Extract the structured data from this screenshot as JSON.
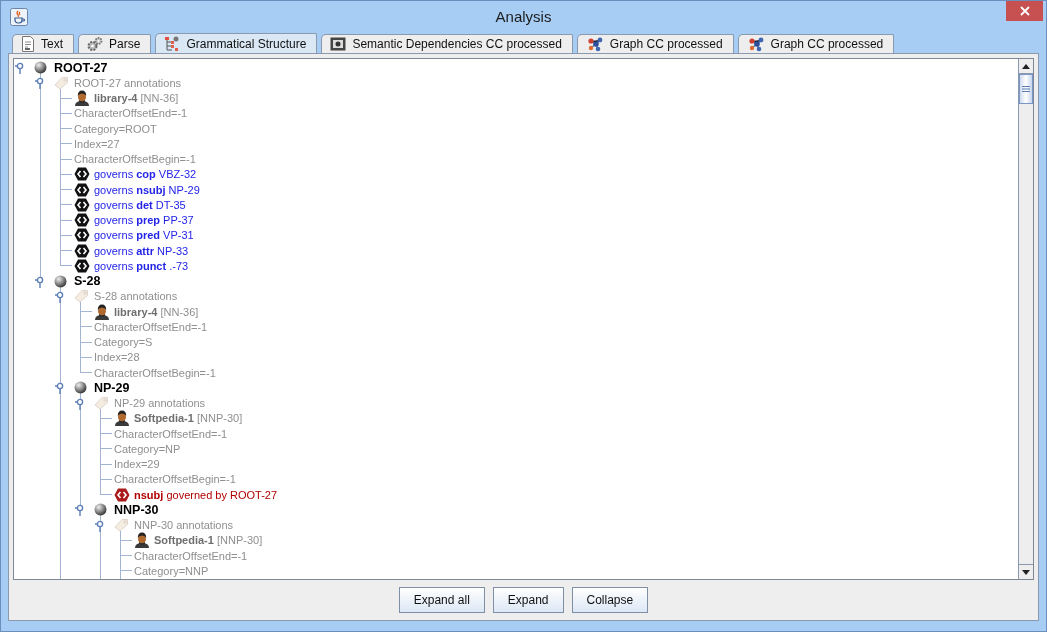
{
  "window": {
    "title": "Analysis"
  },
  "tabs": [
    {
      "label": "Text",
      "selected": false
    },
    {
      "label": "Parse",
      "selected": false
    },
    {
      "label": "Grammatical Structure",
      "selected": true
    },
    {
      "label": "Semantic Dependencies CC processed",
      "selected": false
    },
    {
      "label": "Graph CC processed",
      "selected": false
    },
    {
      "label": "Graph CC processed",
      "selected": false
    }
  ],
  "tree": [
    {
      "kind": "node",
      "label": "ROOT-27",
      "expanded": true,
      "children": [
        {
          "kind": "annotations",
          "label": "ROOT-27 annotations",
          "expanded": true,
          "children": [
            {
              "kind": "token",
              "label": "**library-4** [NN-36]"
            },
            {
              "kind": "property",
              "label": "CharacterOffsetEnd=-1"
            },
            {
              "kind": "property",
              "label": "Category=ROOT"
            },
            {
              "kind": "property",
              "label": "Index=27"
            },
            {
              "kind": "property",
              "label": "CharacterOffsetBegin=-1"
            },
            {
              "kind": "governs",
              "label": "governs **cop** VBZ-32"
            },
            {
              "kind": "governs",
              "label": "governs **nsubj** NP-29"
            },
            {
              "kind": "governs",
              "label": "governs **det** DT-35"
            },
            {
              "kind": "governs",
              "label": "governs **prep** PP-37"
            },
            {
              "kind": "governs",
              "label": "governs **pred** VP-31"
            },
            {
              "kind": "governs",
              "label": "governs **attr** NP-33"
            },
            {
              "kind": "governs",
              "label": "governs **punct** .-73"
            }
          ]
        },
        {
          "kind": "node",
          "label": "S-28",
          "expanded": true,
          "more_below": true,
          "children": [
            {
              "kind": "annotations",
              "label": "S-28 annotations",
              "expanded": true,
              "children": [
                {
                  "kind": "token",
                  "label": "**library-4** [NN-36]"
                },
                {
                  "kind": "property",
                  "label": "CharacterOffsetEnd=-1"
                },
                {
                  "kind": "property",
                  "label": "Category=S"
                },
                {
                  "kind": "property",
                  "label": "Index=28"
                },
                {
                  "kind": "property",
                  "label": "CharacterOffsetBegin=-1"
                }
              ]
            },
            {
              "kind": "node",
              "label": "NP-29",
              "expanded": true,
              "children": [
                {
                  "kind": "annotations",
                  "label": "NP-29 annotations",
                  "expanded": true,
                  "children": [
                    {
                      "kind": "token",
                      "label": "**Softpedia-1** [NNP-30]"
                    },
                    {
                      "kind": "property",
                      "label": "CharacterOffsetEnd=-1"
                    },
                    {
                      "kind": "property",
                      "label": "Category=NP"
                    },
                    {
                      "kind": "property",
                      "label": "Index=29"
                    },
                    {
                      "kind": "property",
                      "label": "CharacterOffsetBegin=-1"
                    },
                    {
                      "kind": "governed",
                      "label": "**nsubj** governed by ROOT-27"
                    }
                  ]
                },
                {
                  "kind": "node",
                  "label": "NNP-30",
                  "expanded": true,
                  "more_below": true,
                  "children": [
                    {
                      "kind": "annotations",
                      "label": "NNP-30 annotations",
                      "expanded": true,
                      "more_below": true,
                      "children": [
                        {
                          "kind": "token",
                          "label": "**Softpedia-1** [NNP-30]"
                        },
                        {
                          "kind": "property",
                          "label": "CharacterOffsetEnd=-1"
                        },
                        {
                          "kind": "property",
                          "label": "Category=NNP"
                        }
                      ]
                    }
                  ]
                }
              ]
            }
          ]
        }
      ]
    }
  ],
  "buttons": [
    "Expand all",
    "Expand",
    "Collapse"
  ]
}
